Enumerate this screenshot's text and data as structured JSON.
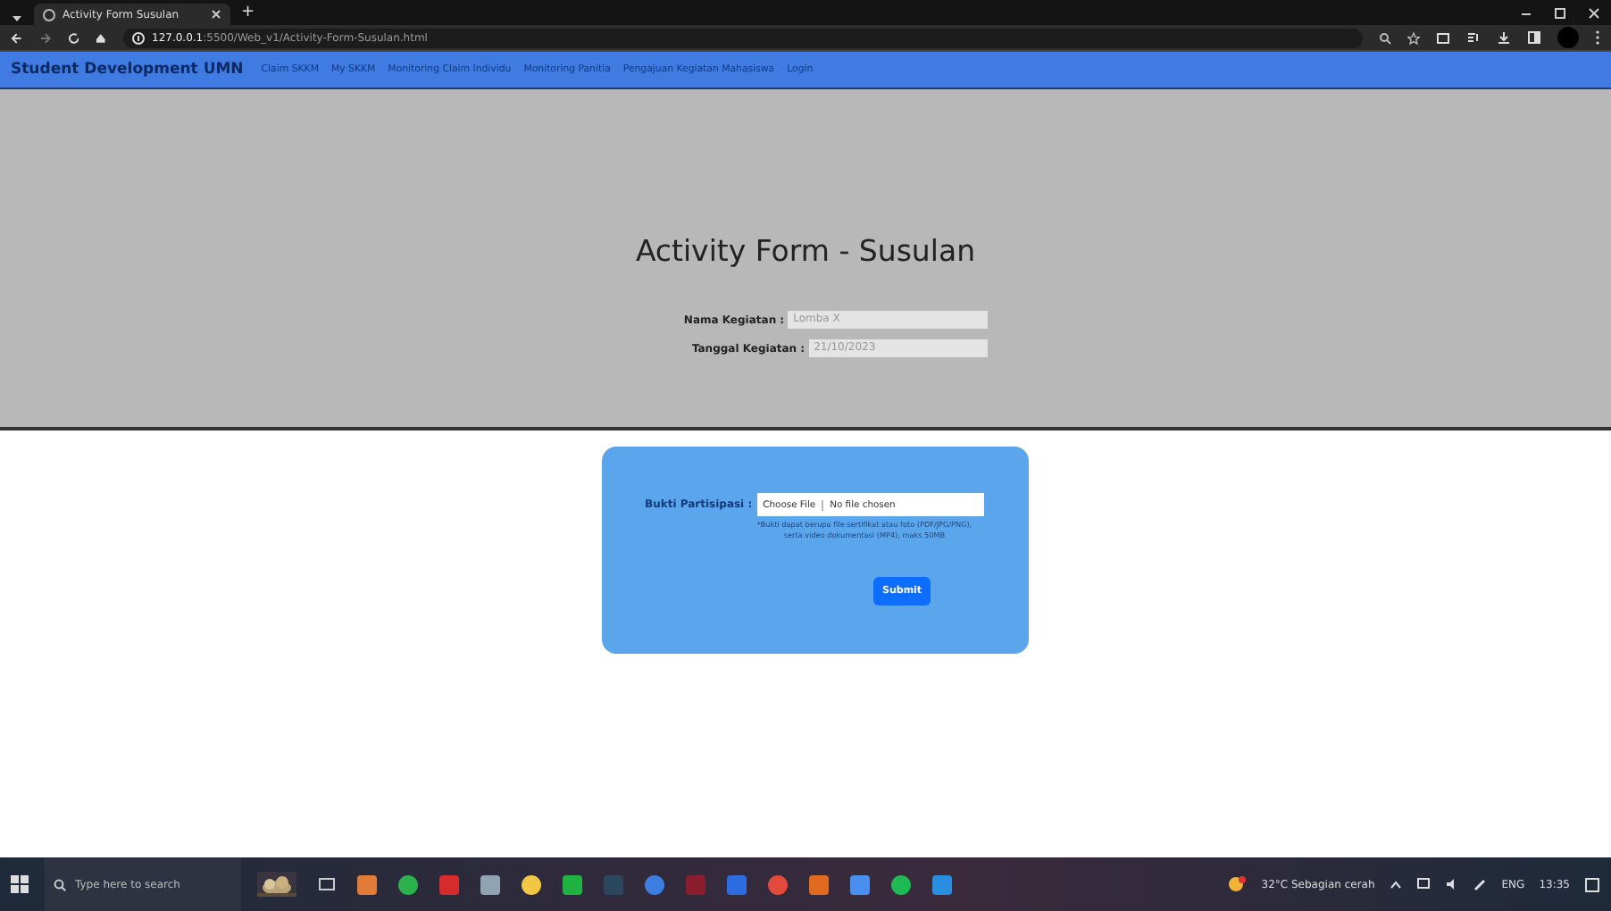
{
  "browser": {
    "tab_title": "Activity Form Susulan",
    "new_tab": "+",
    "url_host": "127.0.0.1",
    "url_rest": ":5500/Web_v1/Activity-Form-Susulan.html"
  },
  "navbar": {
    "brand": "Student Development UMN",
    "links": [
      "Claim SKKM",
      "My SKKM",
      "Monitoring Claim Individu",
      "Monitoring Panitia",
      "Pengajuan Kegiatan Mahasiswa",
      "Login"
    ]
  },
  "heading": "Activity Form - Susulan",
  "fields": [
    {
      "label": "Nama Kegiatan :",
      "value": "Lomba X"
    },
    {
      "label": "Tanggal Kegiatan :",
      "value": "21/10/2023"
    }
  ],
  "upload": {
    "label": "Bukti Partisipasi :",
    "button": "Choose File",
    "status": "No file chosen",
    "hint": "*Bukti dapat berupa file sertifikat atau foto (PDF/JPG/PNG), serta video dokumentasi (MP4), maks 50MB",
    "submit": "Submit"
  },
  "taskbar": {
    "search_placeholder": "Type here to search",
    "apps": [
      {
        "color": "#e07b39"
      },
      {
        "color": "#2bb24c"
      },
      {
        "color": "#d62b2b"
      },
      {
        "color": "#8fa3b5"
      },
      {
        "color": "#f2c744"
      },
      {
        "color": "#1fb141"
      },
      {
        "color": "#2a475e"
      },
      {
        "color": "#3b7de0"
      },
      {
        "color": "#8b1e2e"
      },
      {
        "color": "#2d6be0"
      },
      {
        "color": "#e24a3b"
      },
      {
        "color": "#e06a1f"
      },
      {
        "color": "#4a8ff0"
      },
      {
        "color": "#1db954"
      },
      {
        "color": "#2a8ee0"
      }
    ],
    "weather": "32°C  Sebagian cerah",
    "language": "ENG",
    "time": "13:35"
  }
}
